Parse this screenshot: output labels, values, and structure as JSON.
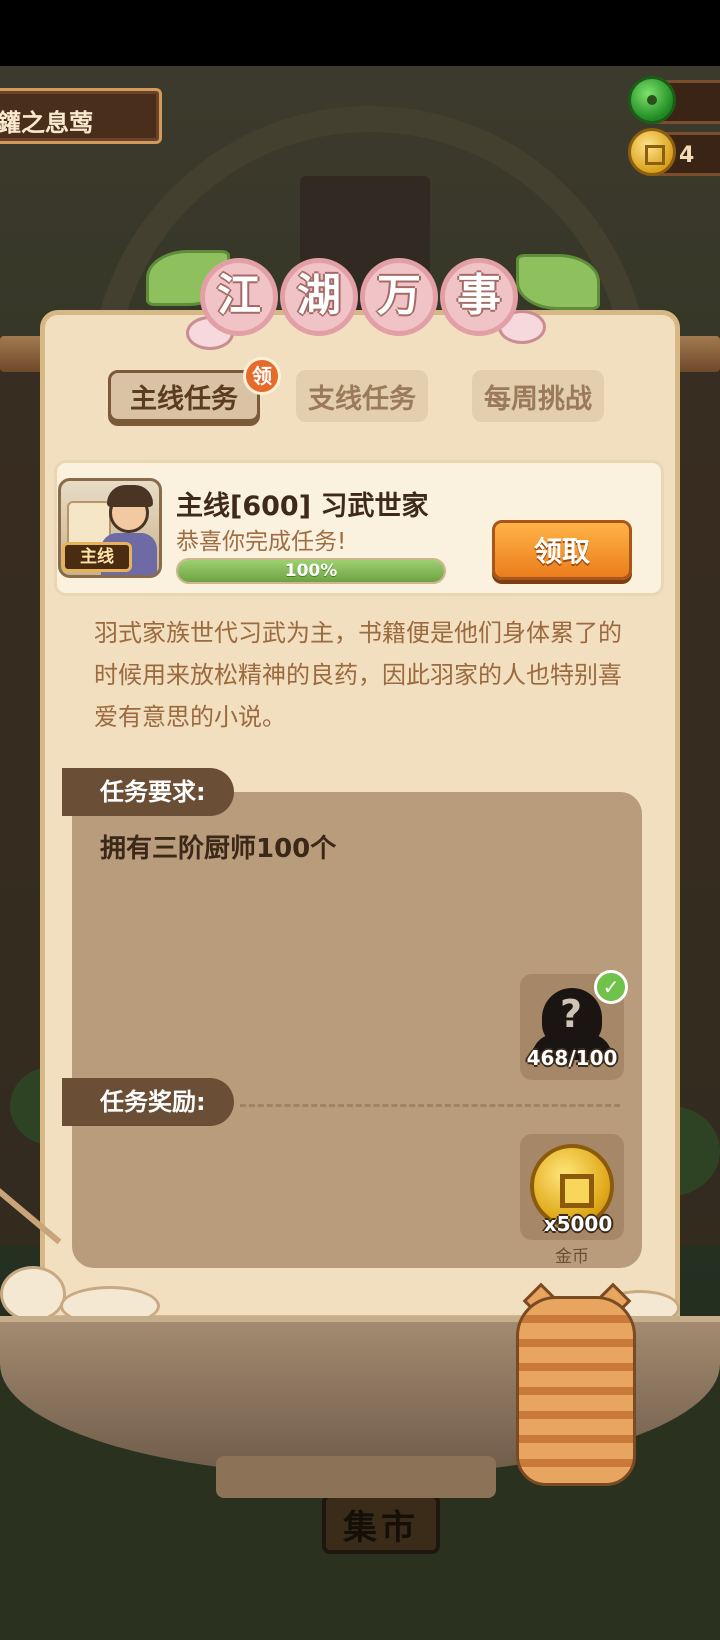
{
  "top_left": {
    "name": "鑵之息莺"
  },
  "currencies": [
    {
      "icon": "jade-icon",
      "value": ""
    },
    {
      "icon": "gold-coin-icon",
      "value": "4"
    }
  ],
  "panel": {
    "title_chars": [
      "江",
      "湖",
      "万",
      "事"
    ],
    "tabs": [
      {
        "label": "主线任务",
        "active": true,
        "badge": "领"
      },
      {
        "label": "支线任务",
        "active": false
      },
      {
        "label": "每周挑战",
        "active": false
      }
    ],
    "quest": {
      "badge": "主线",
      "title": "主线[600] 习武世家",
      "status": "恭喜你完成任务!",
      "progress_text": "100%",
      "progress_value": 1.0,
      "claim_label": "领取"
    },
    "description": "羽式家族世代习武为主，书籍便是他们身体累了的时候用来放松精神的良药，因此羽家的人也特别喜爱有意思的小说。",
    "requirement": {
      "label": "任务要求:",
      "text": "拥有三阶厨师100个",
      "item_count": "468/100"
    },
    "reward": {
      "label": "任务奖励:",
      "item_count": "x5000",
      "item_name": "金币"
    }
  },
  "bottom": {
    "market_label": "集市"
  },
  "colors": {
    "claim_button": "#ea7d1c",
    "progress_fill": "#6ea244",
    "panel_bg": "#f1dfbf"
  }
}
